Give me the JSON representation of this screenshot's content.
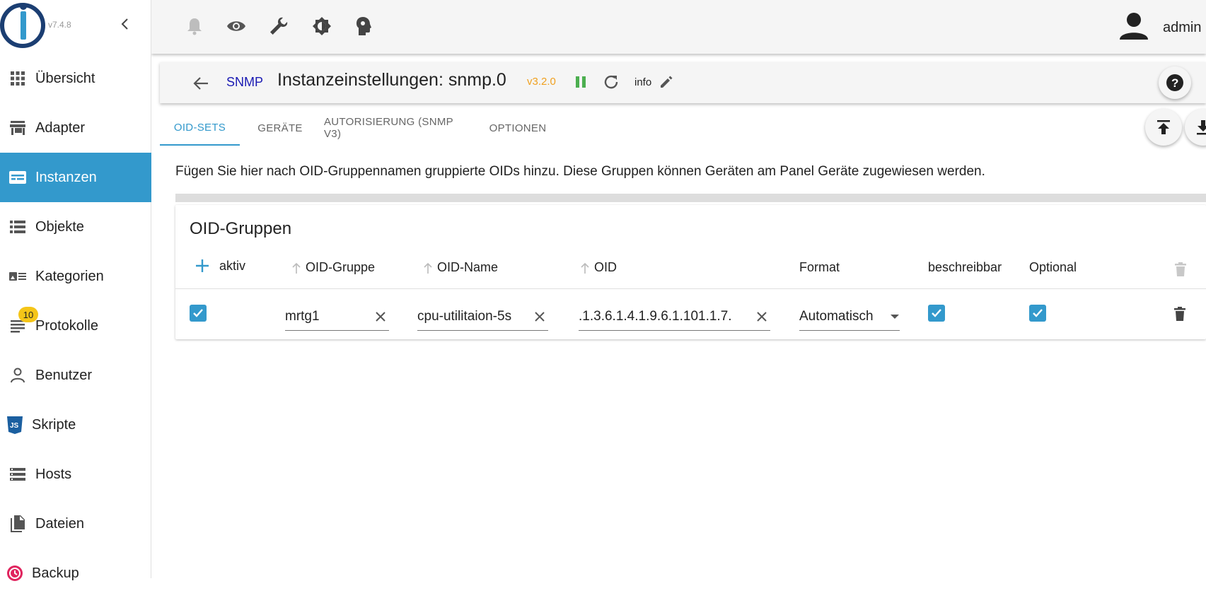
{
  "app": {
    "version": "v7.4.8"
  },
  "topbar": {
    "username": "admin"
  },
  "sidebar": {
    "items": [
      {
        "label": "Übersicht"
      },
      {
        "label": "Adapter"
      },
      {
        "label": "Instanzen",
        "active": true
      },
      {
        "label": "Objekte"
      },
      {
        "label": "Kategorien"
      },
      {
        "label": "Protokolle",
        "badge": "10"
      },
      {
        "label": "Benutzer"
      },
      {
        "label": "Skripte"
      },
      {
        "label": "Hosts"
      },
      {
        "label": "Dateien"
      },
      {
        "label": "Backup"
      }
    ]
  },
  "instance": {
    "adapter": "SNMP",
    "title": "Instanzeinstellungen: snmp.0",
    "version": "v3.2.0",
    "info_label": "info"
  },
  "tabs": [
    {
      "label": "OID-SETS",
      "active": true
    },
    {
      "label": "GERÄTE"
    },
    {
      "label": "AUTORISIERUNG (SNMP V3)"
    },
    {
      "label": "OPTIONEN"
    }
  ],
  "description": "Fügen Sie hier nach OID-Gruppennamen gruppierte OIDs hinzu. Diese Gruppen können Geräten am Panel Geräte zugewiesen werden.",
  "oid_table": {
    "title": "OID-Gruppen",
    "headers": {
      "aktiv": "aktiv",
      "group": "OID-Gruppe",
      "name": "OID-Name",
      "oid": "OID",
      "format": "Format",
      "writable": "beschreibbar",
      "optional": "Optional"
    },
    "rows": [
      {
        "aktiv": true,
        "group": "mrtg1",
        "name": "cpu-utilitaion-5s",
        "oid": ".1.3.6.1.4.1.9.6.1.101.1.7.",
        "format": "Automatisch",
        "writable": true,
        "optional": true
      }
    ]
  },
  "colors": {
    "accent": "#3399cc",
    "running": "#4caf50",
    "version": "#f0a020",
    "adapter_name": "#1a1ab3"
  }
}
